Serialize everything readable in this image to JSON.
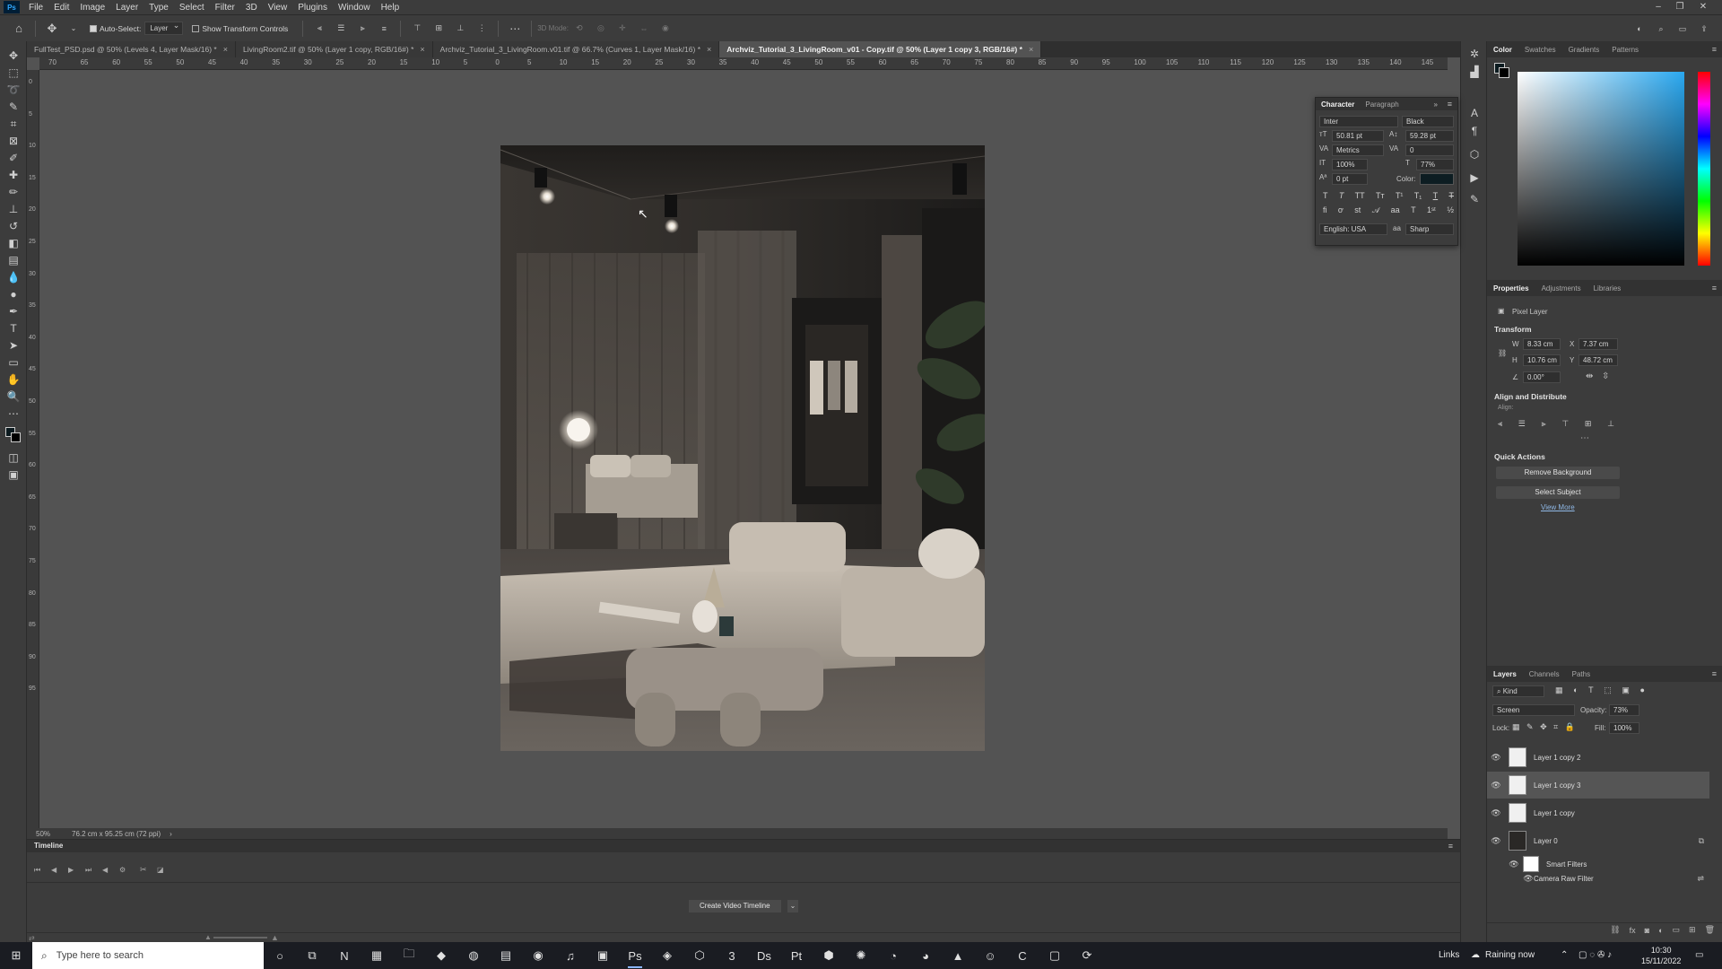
{
  "menubar": {
    "items": [
      "File",
      "Edit",
      "Image",
      "Layer",
      "Type",
      "Select",
      "Filter",
      "3D",
      "View",
      "Plugins",
      "Window",
      "Help"
    ]
  },
  "options": {
    "auto_select_label": "Auto-Select:",
    "auto_select_value": "Layer",
    "show_transform_label": "Show Transform Controls",
    "mode_3d_label": "3D Mode:"
  },
  "tabs": [
    {
      "label": "FullTest_PSD.psd @ 50% (Levels 4, Layer Mask/16) *",
      "active": false
    },
    {
      "label": "LivingRoom2.tif @ 50% (Layer 1 copy, RGB/16#) *",
      "active": false
    },
    {
      "label": "Archviz_Tutorial_3_LivingRoom.v01.tif @ 66.7% (Curves 1, Layer Mask/16) *",
      "active": false
    },
    {
      "label": "Archviz_Tutorial_3_LivingRoom_v01 - Copy.tif @ 50% (Layer 1 copy 3, RGB/16#) *",
      "active": true
    }
  ],
  "ruler_h": [
    "70",
    "65",
    "60",
    "55",
    "50",
    "45",
    "40",
    "35",
    "30",
    "25",
    "20",
    "15",
    "10",
    "5",
    "0",
    "5",
    "10",
    "15",
    "20",
    "25",
    "30",
    "35",
    "40",
    "45",
    "50",
    "55",
    "60",
    "65",
    "70",
    "75",
    "80",
    "85",
    "90",
    "95",
    "100",
    "105",
    "110",
    "115",
    "120",
    "125",
    "130",
    "135",
    "140",
    "145"
  ],
  "ruler_v": [
    "0",
    "5",
    "10",
    "15",
    "20",
    "25",
    "30",
    "35",
    "40",
    "45",
    "50",
    "55",
    "60",
    "65",
    "70",
    "75",
    "80",
    "85",
    "90",
    "95"
  ],
  "status": {
    "zoom": "50%",
    "doc_size": "76.2 cm x 95.25 cm (72 ppi)"
  },
  "timeline": {
    "title": "Timeline",
    "create_button": "Create Video Timeline"
  },
  "character": {
    "tabs": [
      "Character",
      "Paragraph"
    ],
    "font_family": "Inter",
    "font_style": "Black",
    "font_size": "50.81 pt",
    "leading": "59.28 pt",
    "kerning": "Metrics",
    "tracking": "0",
    "vertical_scale": "100%",
    "horizontal_scale": "77%",
    "baseline_shift": "0 pt",
    "color_label": "Color:",
    "language": "English: USA",
    "antialias": "Sharp",
    "color_swatch": "#0d1d22"
  },
  "color_panel": {
    "tabs": [
      "Color",
      "Swatches",
      "Gradients",
      "Patterns"
    ],
    "hue": "#2aa8f0"
  },
  "properties": {
    "tabs": [
      "Properties",
      "Adjustments",
      "Libraries"
    ],
    "layer_type": "Pixel Layer",
    "transform_title": "Transform",
    "w_label": "W",
    "w": "8.33 cm",
    "h_label": "H",
    "h": "10.76 cm",
    "x_label": "X",
    "x": "7.37 cm",
    "y_label": "Y",
    "y": "48.72 cm",
    "angle": "0.00°",
    "align_title": "Align and Distribute",
    "align_label": "Align:",
    "quick_actions_title": "Quick Actions",
    "remove_bg": "Remove Background",
    "select_subject": "Select Subject",
    "view_more": "View More"
  },
  "layers": {
    "tabs": [
      "Layers",
      "Channels",
      "Paths"
    ],
    "filter_kind": "Kind",
    "blend_mode": "Screen",
    "opacity_label": "Opacity:",
    "opacity": "73%",
    "lock_label": "Lock:",
    "fill_label": "Fill:",
    "fill": "100%",
    "items": [
      {
        "name": "Layer 1 copy 2",
        "selected": false
      },
      {
        "name": "Layer 1 copy 3",
        "selected": true
      },
      {
        "name": "Layer 1 copy",
        "selected": false
      },
      {
        "name": "Layer 0",
        "selected": false
      }
    ],
    "smart_filters": "Smart Filters",
    "camera_raw": "Camera Raw Filter"
  },
  "taskbar": {
    "search_placeholder": "Type here to search",
    "links": "Links",
    "weather": "Raining now",
    "time": "10:30",
    "date": "15/11/2022"
  }
}
